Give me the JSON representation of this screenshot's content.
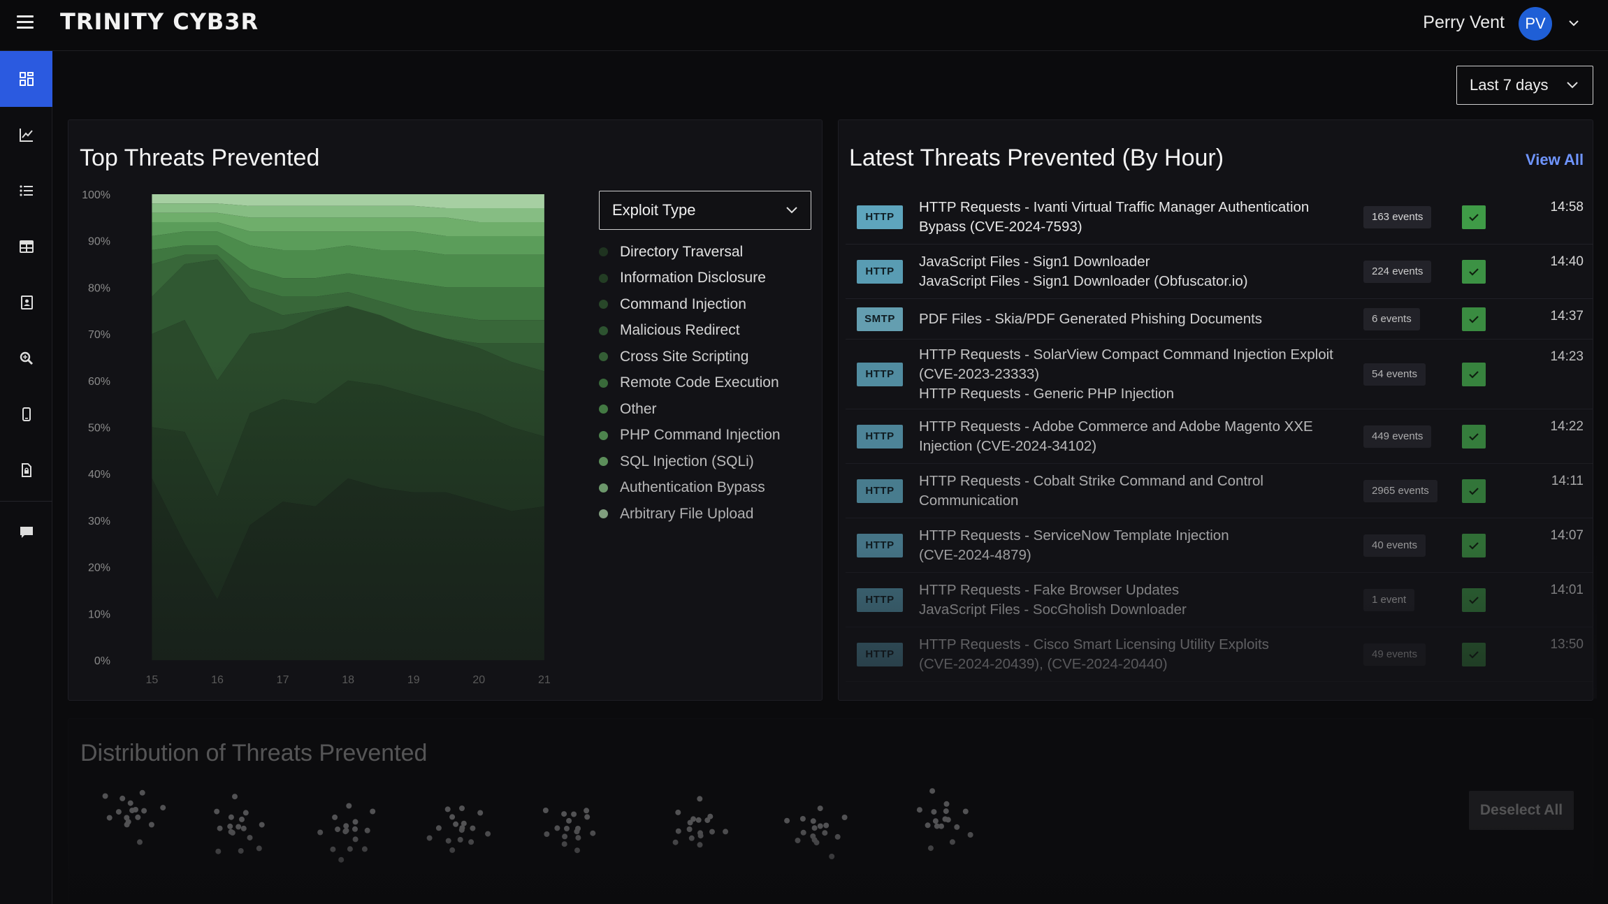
{
  "header": {
    "logo": "TRINITY CYB3R",
    "user_name": "Perry Vent",
    "user_initials": "PV"
  },
  "sidebar": {
    "icons": [
      "dashboard-icon",
      "line-chart-icon",
      "list-icon",
      "table-icon",
      "contacts-book-icon",
      "search-zoom-icon",
      "mobile-device-icon",
      "document-lock-icon",
      "chat-icon"
    ]
  },
  "date_range": {
    "selected": "Last 7 days"
  },
  "top_threats": {
    "title": "Top Threats Prevented",
    "filter": {
      "selected": "Exploit Type"
    },
    "legend": [
      {
        "label": "Directory Traversal",
        "color": "#1f3320"
      },
      {
        "label": "Information Disclosure",
        "color": "#243f25"
      },
      {
        "label": "Command Injection",
        "color": "#2a4a2b"
      },
      {
        "label": "Malicious Redirect",
        "color": "#305832"
      },
      {
        "label": "Cross Site Scripting",
        "color": "#386739"
      },
      {
        "label": "Remote Code Execution",
        "color": "#3f7740"
      },
      {
        "label": "Other",
        "color": "#4c8c4c"
      },
      {
        "label": "PHP Command Injection",
        "color": "#5b9d5a"
      },
      {
        "label": "SQL Injection (SQLi)",
        "color": "#6fae6b"
      },
      {
        "label": "Authentication Bypass",
        "color": "#86bd83"
      },
      {
        "label": "Arbitrary File Upload",
        "color": "#a6cfa2"
      }
    ]
  },
  "chart_data": {
    "type": "area",
    "stacked": "percent",
    "title": "Top Threats Prevented",
    "x": [
      "15",
      "16",
      "17",
      "18",
      "19",
      "20",
      "21"
    ],
    "x_values": [
      15,
      15.5,
      16,
      16.5,
      17,
      17.5,
      18,
      18.5,
      19,
      19.5,
      20,
      20.5,
      21
    ],
    "ylim": [
      0,
      100
    ],
    "yticks": [
      "100%",
      "90%",
      "80%",
      "70%",
      "60%",
      "50%",
      "40%",
      "30%",
      "20%",
      "10%",
      "0%"
    ],
    "boundaries_pct": [
      [
        39,
        25,
        13,
        29,
        34,
        33,
        39,
        37,
        36,
        36,
        34,
        32,
        33
      ],
      [
        50,
        49,
        35,
        53,
        56,
        55,
        60,
        59,
        57,
        55,
        53,
        50,
        48
      ],
      [
        70,
        73,
        60,
        70,
        71,
        74,
        76,
        74,
        71,
        69,
        67,
        64,
        62
      ],
      [
        78,
        85,
        86,
        77,
        74,
        75,
        76,
        73,
        71,
        69,
        68,
        68,
        68
      ],
      [
        85,
        87,
        87,
        80,
        78,
        78,
        79,
        77,
        75,
        74,
        73,
        73,
        73
      ],
      [
        88,
        89,
        89,
        84,
        82,
        82,
        83,
        82,
        81,
        80,
        80,
        80,
        80
      ],
      [
        91,
        92,
        92,
        89,
        88,
        88,
        89,
        88,
        88,
        87,
        87,
        87,
        87
      ],
      [
        94,
        94,
        94,
        92,
        92,
        92,
        92,
        92,
        92,
        91,
        91,
        91,
        91
      ],
      [
        96,
        96,
        96,
        95,
        95,
        95,
        95,
        95,
        95,
        95,
        94,
        94,
        94
      ],
      [
        98,
        98,
        98,
        97.5,
        97.5,
        97.5,
        97.5,
        97.5,
        97.5,
        97,
        97,
        97,
        97
      ],
      [
        100,
        100,
        100,
        100,
        100,
        100,
        100,
        100,
        100,
        100,
        100,
        100,
        100
      ]
    ],
    "series": [
      {
        "name": "Directory Traversal"
      },
      {
        "name": "Information Disclosure"
      },
      {
        "name": "Command Injection"
      },
      {
        "name": "Malicious Redirect"
      },
      {
        "name": "Cross Site Scripting"
      },
      {
        "name": "Remote Code Execution"
      },
      {
        "name": "Other"
      },
      {
        "name": "PHP Command Injection"
      },
      {
        "name": "SQL Injection (SQLi)"
      },
      {
        "name": "Authentication Bypass"
      },
      {
        "name": "Arbitrary File Upload"
      }
    ],
    "legend_position": "right",
    "grid": false
  },
  "latest_threats": {
    "title": "Latest Threats Prevented (By Hour)",
    "view_all": "View All",
    "rows": [
      {
        "proto": "HTTP",
        "lines": [
          "HTTP Requests - Ivanti Virtual Traffic Manager Authentication",
          "Bypass (CVE-2024-7593)"
        ],
        "events": "163 events",
        "time": "14:58"
      },
      {
        "proto": "HTTP",
        "lines": [
          "JavaScript Files - Sign1 Downloader",
          "JavaScript Files - Sign1 Downloader (Obfuscator.io)"
        ],
        "events": "224 events",
        "time": "14:40"
      },
      {
        "proto": "SMTP",
        "lines": [
          "PDF Files - Skia/PDF Generated Phishing Documents"
        ],
        "events": "6 events",
        "time": "14:37"
      },
      {
        "proto": "HTTP",
        "lines": [
          "HTTP Requests - SolarView Compact Command Injection Exploit",
          "(CVE-2023-23333)",
          "HTTP Requests - Generic PHP Injection"
        ],
        "events": "54 events",
        "time": "14:23"
      },
      {
        "proto": "HTTP",
        "lines": [
          "HTTP Requests - Adobe Commerce and Adobe Magento XXE",
          "Injection (CVE-2024-34102)"
        ],
        "events": "449 events",
        "time": "14:22"
      },
      {
        "proto": "HTTP",
        "lines": [
          "HTTP Requests - Cobalt Strike Command and Control",
          "Communication"
        ],
        "events": "2965 events",
        "time": "14:11"
      },
      {
        "proto": "HTTP",
        "lines": [
          "HTTP Requests - ServiceNow Template Injection",
          "(CVE-2024-4879)"
        ],
        "events": "40 events",
        "time": "14:07"
      },
      {
        "proto": "HTTP",
        "lines": [
          "HTTP Requests - Fake Browser Updates",
          "JavaScript Files - SocGholish Downloader"
        ],
        "events": "1 event",
        "time": "14:01"
      },
      {
        "proto": "HTTP",
        "lines": [
          "HTTP Requests - Cisco Smart Licensing Utility Exploits",
          "(CVE-2024-20439), (CVE-2024-20440)"
        ],
        "events": "49 events",
        "time": "13:50"
      }
    ]
  },
  "distribution": {
    "title": "Distribution of Threats Prevented",
    "deselect_all": "Deselect All"
  }
}
